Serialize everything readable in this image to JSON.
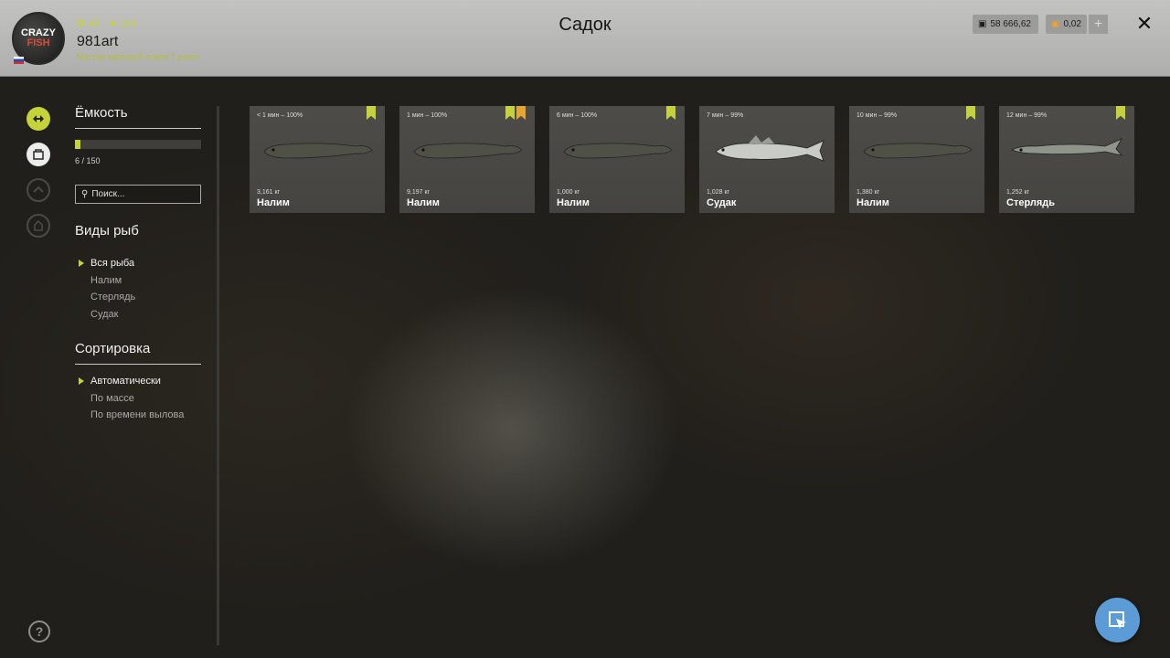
{
  "header": {
    "title": "Садок",
    "logo_text": [
      "CRAZY",
      "FISH"
    ],
    "coins": "49",
    "stars": "124",
    "username": "981art",
    "rank": "Мастер карповой ловли 7 ранга",
    "silver": "58 666,62",
    "gold": "0,02",
    "plus_label": "+",
    "close_label": "✕"
  },
  "colors": {
    "accent": "#c6d23a",
    "bookmark_orange": "#e6a531",
    "fab_blue": "#5b9bd6"
  },
  "sidebar": {
    "capacity_heading": "Ёмкость",
    "capacity_used": 6,
    "capacity_max": 150,
    "capacity_text": "6 / 150",
    "search_placeholder": "Поиск...",
    "species_heading": "Виды рыб",
    "species": [
      {
        "label": "Вся рыба",
        "active": true
      },
      {
        "label": "Налим",
        "active": false
      },
      {
        "label": "Стерлядь",
        "active": false
      },
      {
        "label": "Судак",
        "active": false
      }
    ],
    "sort_heading": "Сортировка",
    "sort": [
      {
        "label": "Автоматически",
        "active": true
      },
      {
        "label": "По массе",
        "active": false
      },
      {
        "label": "По времени вылова",
        "active": false
      }
    ]
  },
  "rail_icons": [
    "fish-keepnet-icon",
    "inventory-icon",
    "rank-icon",
    "trophy-icon"
  ],
  "help_label": "?",
  "fish": [
    {
      "meta": "< 1 мин – 100%",
      "weight": "3,161 кг",
      "name": "Налим",
      "bookmarks": [
        "green"
      ],
      "kind": "burbot"
    },
    {
      "meta": "1 мин – 100%",
      "weight": "9,197 кг",
      "name": "Налим",
      "bookmarks": [
        "green",
        "orange"
      ],
      "kind": "burbot"
    },
    {
      "meta": "6 мин – 100%",
      "weight": "1,000 кг",
      "name": "Налим",
      "bookmarks": [
        "green"
      ],
      "kind": "burbot"
    },
    {
      "meta": "7 мин – 99%",
      "weight": "1,028 кг",
      "name": "Судак",
      "bookmarks": [],
      "kind": "zander"
    },
    {
      "meta": "10 мин – 99%",
      "weight": "1,380 кг",
      "name": "Налим",
      "bookmarks": [
        "green"
      ],
      "kind": "burbot"
    },
    {
      "meta": "12 мин – 99%",
      "weight": "1,252 кг",
      "name": "Стерлядь",
      "bookmarks": [
        "green"
      ],
      "kind": "sterlet"
    }
  ]
}
